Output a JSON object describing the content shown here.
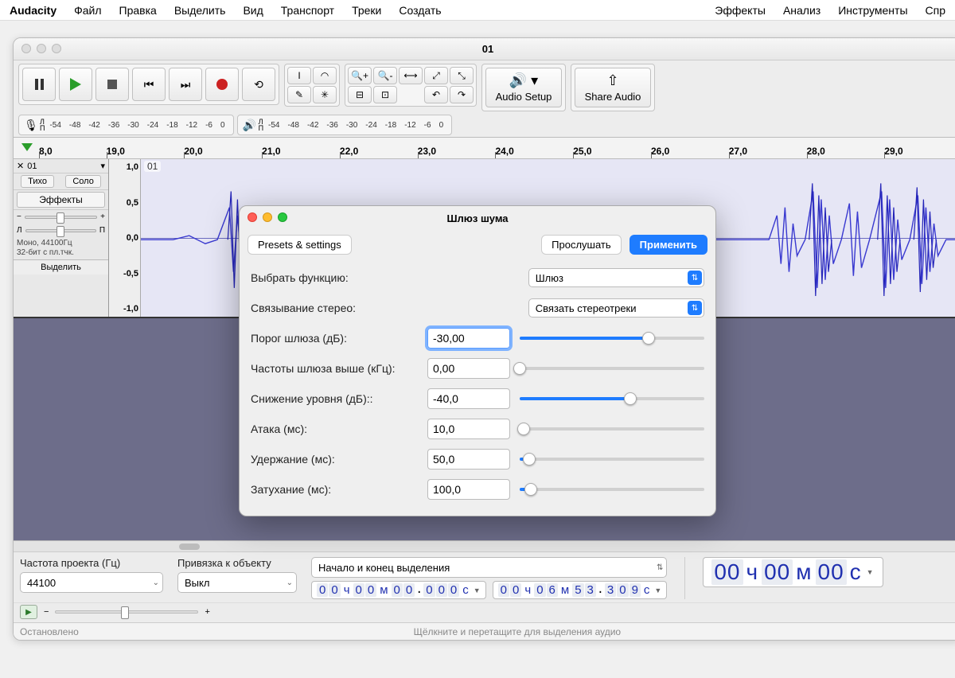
{
  "menubar": {
    "app": "Audacity",
    "items": [
      "Файл",
      "Правка",
      "Выделить",
      "Вид",
      "Транспорт",
      "Треки",
      "Создать"
    ],
    "items_right": [
      "Эффекты",
      "Анализ",
      "Инструменты",
      "Спр"
    ]
  },
  "window": {
    "title": "01"
  },
  "toolbar": {
    "audio_setup": "Audio Setup",
    "share_audio": "Share Audio"
  },
  "meters": {
    "rec_ticks": [
      "-54",
      "-48",
      "-42",
      "-36",
      "-30",
      "-24",
      "-18",
      "-12",
      "-6",
      "0"
    ],
    "play_ticks": [
      "-54",
      "-48",
      "-42",
      "-36",
      "-30",
      "-24",
      "-18",
      "-12",
      "-6",
      "0"
    ],
    "lp": "Л\nП"
  },
  "ruler": {
    "ticks": [
      "8,0",
      "19,0",
      "20,0",
      "21,0",
      "22,0",
      "23,0",
      "24,0",
      "25,0",
      "26,0",
      "27,0",
      "28,0",
      "29,0"
    ]
  },
  "track": {
    "name": "01",
    "mute": "Тихо",
    "solo": "Соло",
    "effects": "Эффекты",
    "pan_left": "Л",
    "pan_right": "П",
    "format_line1": "Моно, 44100Гц",
    "format_line2": "32-бит с пл.тчк.",
    "select": "Выделить",
    "vscale": [
      "1,0",
      "0,5",
      "0,0",
      "-0,5",
      "-1,0"
    ]
  },
  "dialog": {
    "title": "Шлюз шума",
    "presets": "Presets & settings",
    "preview": "Прослушать",
    "apply": "Применить",
    "rows": {
      "func_label": "Выбрать функцию:",
      "func_value": "Шлюз",
      "stereo_label": "Связывание стерео:",
      "stereo_value": "Связать стереотреки",
      "threshold_label": "Порог шлюза (дБ):",
      "threshold_value": "-30,00",
      "freq_label": "Частоты шлюза выше (кГц):",
      "freq_value": "0,00",
      "reduce_label": "Снижение уровня (дБ)::",
      "reduce_value": "-40,0",
      "attack_label": "Атака (мс):",
      "attack_value": "10,0",
      "hold_label": "Удержание (мс):",
      "hold_value": "50,0",
      "decay_label": "Затухание (мс):",
      "decay_value": "100,0"
    },
    "slider_fill": {
      "threshold": 70,
      "freq": 0,
      "reduce": 60,
      "attack": 2,
      "hold": 5,
      "decay": 6
    }
  },
  "bottom": {
    "project_rate_label": "Частота проекта (Гц)",
    "project_rate_value": "44100",
    "snap_label": "Привязка к объекту",
    "snap_value": "Выкл",
    "selection_mode": "Начало и конец выделения",
    "sel_start_digits": [
      "0",
      "0",
      "0",
      "0",
      "0",
      "0",
      ".",
      "0",
      "0",
      "0"
    ],
    "sel_start_text": "00 ч 00 м 00.000 с",
    "sel_end_text": "00 ч 06 м 53.309 с",
    "big_time": {
      "h": "00",
      "m": "00",
      "s": "00",
      "uh": "ч",
      "um": "м",
      "us": "с"
    }
  },
  "status": {
    "left": "Остановлено",
    "mid": "Щёлкните и перетащите для выделения аудио"
  }
}
